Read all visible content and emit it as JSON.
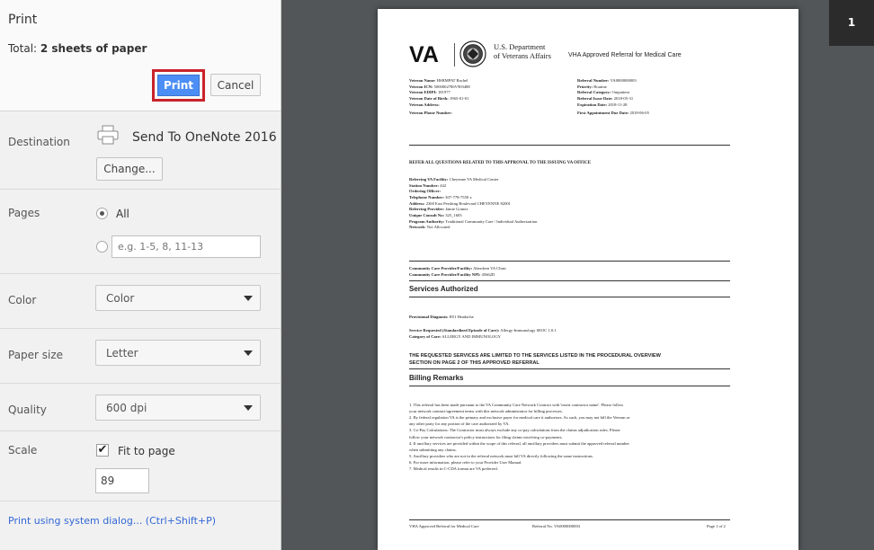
{
  "panel": {
    "title": "Print",
    "total_prefix": "Total: ",
    "total_value": "2 sheets of paper",
    "print_label": "Print",
    "cancel_label": "Cancel",
    "destination": {
      "label": "Destination",
      "name": "Send To OneNote 2016",
      "change_label": "Change..."
    },
    "pages": {
      "label": "Pages",
      "all_label": "All",
      "custom_placeholder": "e.g. 1-5, 8, 11-13",
      "selected": "All"
    },
    "color": {
      "label": "Color",
      "value": "Color"
    },
    "paper_size": {
      "label": "Paper size",
      "value": "Letter"
    },
    "quality": {
      "label": "Quality",
      "value": "600 dpi"
    },
    "scale": {
      "label": "Scale",
      "fit_label": "Fit to page",
      "fit_checked": true,
      "value": "89"
    },
    "system_dialog": "Print using system dialog... (Ctrl+Shift+P)"
  },
  "preview": {
    "page_number": "1",
    "doc": {
      "logo": "VA",
      "dept_line1": "U.S. Department",
      "dept_line2": "of Veterans Affairs",
      "title": "VHA Approved Referral for Medical Care",
      "left_fields": [
        {
          "k": "Veteran Name:",
          "v": "HSRMPAT Rachel"
        },
        {
          "k": "Veteran ICN:",
          "v": "5000002786V903488"
        },
        {
          "k": "Veteran EDIPI:",
          "v": "181977"
        },
        {
          "k": "Veteran Date of Birth:",
          "v": "1965-01-01"
        },
        {
          "k": "Veteran Address:",
          "v": ""
        },
        {
          "k": "Veteran Phone Number:",
          "v": ""
        }
      ],
      "right_fields": [
        {
          "k": "Referral Number:",
          "v": "VA0000000003"
        },
        {
          "k": "Priority:",
          "v": "Routine"
        },
        {
          "k": "Referral Category:",
          "v": "Outpatient"
        },
        {
          "k": "Referral Issue Date:",
          "v": "2018-05-31"
        },
        {
          "k": "Expiration Date:",
          "v": "2018-11-28"
        },
        {
          "k": "First Appointment Due Date:",
          "v": "2018-06-05"
        }
      ],
      "refer_heading": "REFER ALL QUESTIONS RELATED TO THIS APPROVAL TO THE ISSUING VA OFFICE",
      "facility_fields": [
        {
          "k": "Referring VA Facility:",
          "v": "Cheyenne VA Medical Center"
        },
        {
          "k": "Station Number:",
          "v": "442"
        },
        {
          "k": "Ordering Officer:",
          "v": ""
        },
        {
          "k": "Telephone Number:",
          "v": "307-778-7550 x"
        },
        {
          "k": "Address:",
          "v": "2360 East Pershing Boulevard CHEYENNE 82001"
        },
        {
          "k": "Referring Provider:",
          "v": "Jamie Gomez"
        },
        {
          "k": "Unique Consult No:",
          "v": "325_1603"
        },
        {
          "k": "Program Authority:",
          "v": "Traditional Community Care / Individual Authorization"
        },
        {
          "k": "Network:",
          "v": "Not Allocated"
        }
      ],
      "provider_fields": [
        {
          "k": "Community Care Provider/Facility:",
          "v": "Aberdeen VA Clinic"
        },
        {
          "k": "Community Care Provider/Facility NPI:",
          "v": "45662D"
        }
      ],
      "services_heading": "Services Authorized",
      "diagnosis": {
        "k": "Provisional Diagnosis:",
        "v": "R51 Headache"
      },
      "service_requested": {
        "k": "Service Requested (Standardized Episode of Care):",
        "v": "Allergy-Immunology SEOC 1.0.1"
      },
      "category": {
        "k": "Category of Care:",
        "v": "ALLERGY AND IMMUNOLOGY"
      },
      "limited_line1": "THE REQUESTED SERVICES ARE LIMITED TO THE SERVICES LISTED IN THE PROCEDURAL OVERVIEW",
      "limited_line2": "SECTION ON PAGE 2 OF THIS APPROVED REFERRAL",
      "billing_heading": "Billing Remarks",
      "billing_lines": [
        "1. This referral has been made pursuant to the VA Community Care Network Contract with 'insert contractor name'. Please follow",
        "your network contract/agreement terms with this network administrator for billing processes.",
        "2. By federal regulation VA is the primary and exclusive payer for medical care it authorizes. As such, you may not bill the Veteran or",
        "any other party for any portion of the care authorized by VA.",
        "3. Co-Pay Calculations: The Contractor must always exclude any co-pay calculations from the claims adjudication rules. Please",
        "follow your network contractor's policy instructions for filing claims involving co-payments.",
        "4. If ancillary services are provided within the scope of this referral, all ancillary providers must submit the approved referral number",
        "when submitting any claims.",
        "5. Ancillary providers who are not in the referral network must bill VA directly following the same instructions.",
        "6. For more information, please refer to your Provider User Manual.",
        "7. Medical results in C-CDA format are VA preferred."
      ],
      "footer_left": "VHA Approved Referral for Medical Care",
      "footer_mid": "Referral No. VA0000000003",
      "footer_right": "Page 1 of 2"
    }
  },
  "icons": {
    "destination": "printer-icon",
    "select": "caret-down-icon",
    "checkbox": "checkmark-icon",
    "seal": "va-seal-icon"
  },
  "colors": {
    "print_button": "#4c8ef5",
    "highlight_border": "#c9232a",
    "link": "#3367d6",
    "preview_bg": "#525659"
  }
}
